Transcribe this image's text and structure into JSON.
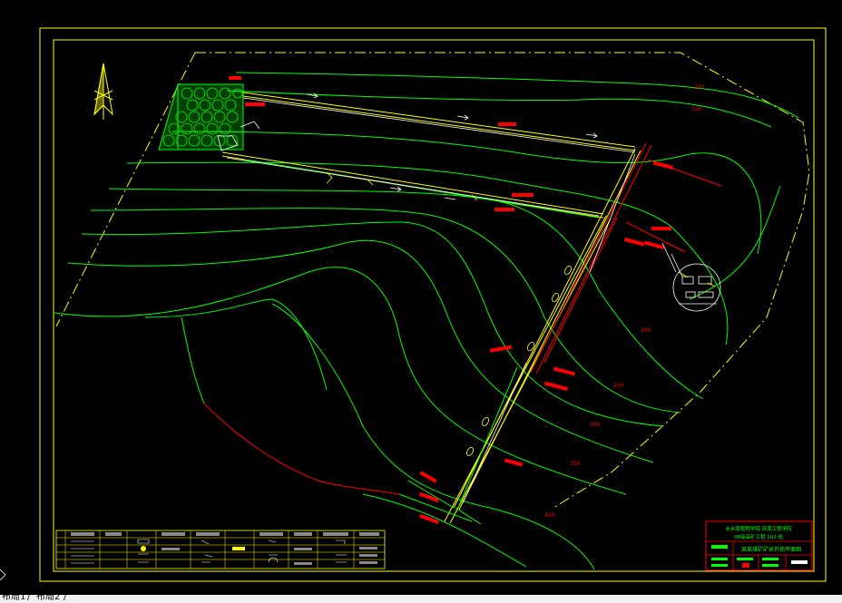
{
  "title_block": {
    "line1": "乡乡局程程学院 资源工程学院",
    "line2": "08级采矿工程 102 班",
    "drawing_title": "某某煤矿矿井开拓平面图"
  },
  "contour_labels": [
    "150",
    "150",
    "200",
    "250",
    "300",
    "350",
    "400"
  ],
  "layout_tabs": [
    "布局1",
    "布局2"
  ],
  "colors": {
    "frame": "#ffff00",
    "contour": "#00ff00",
    "roadway": "#ffff00",
    "annotation": "#ff0000",
    "dashed_boundary": "#ffff00",
    "background": "#000000"
  },
  "icons": {
    "north_arrow": "north-arrow-icon"
  }
}
